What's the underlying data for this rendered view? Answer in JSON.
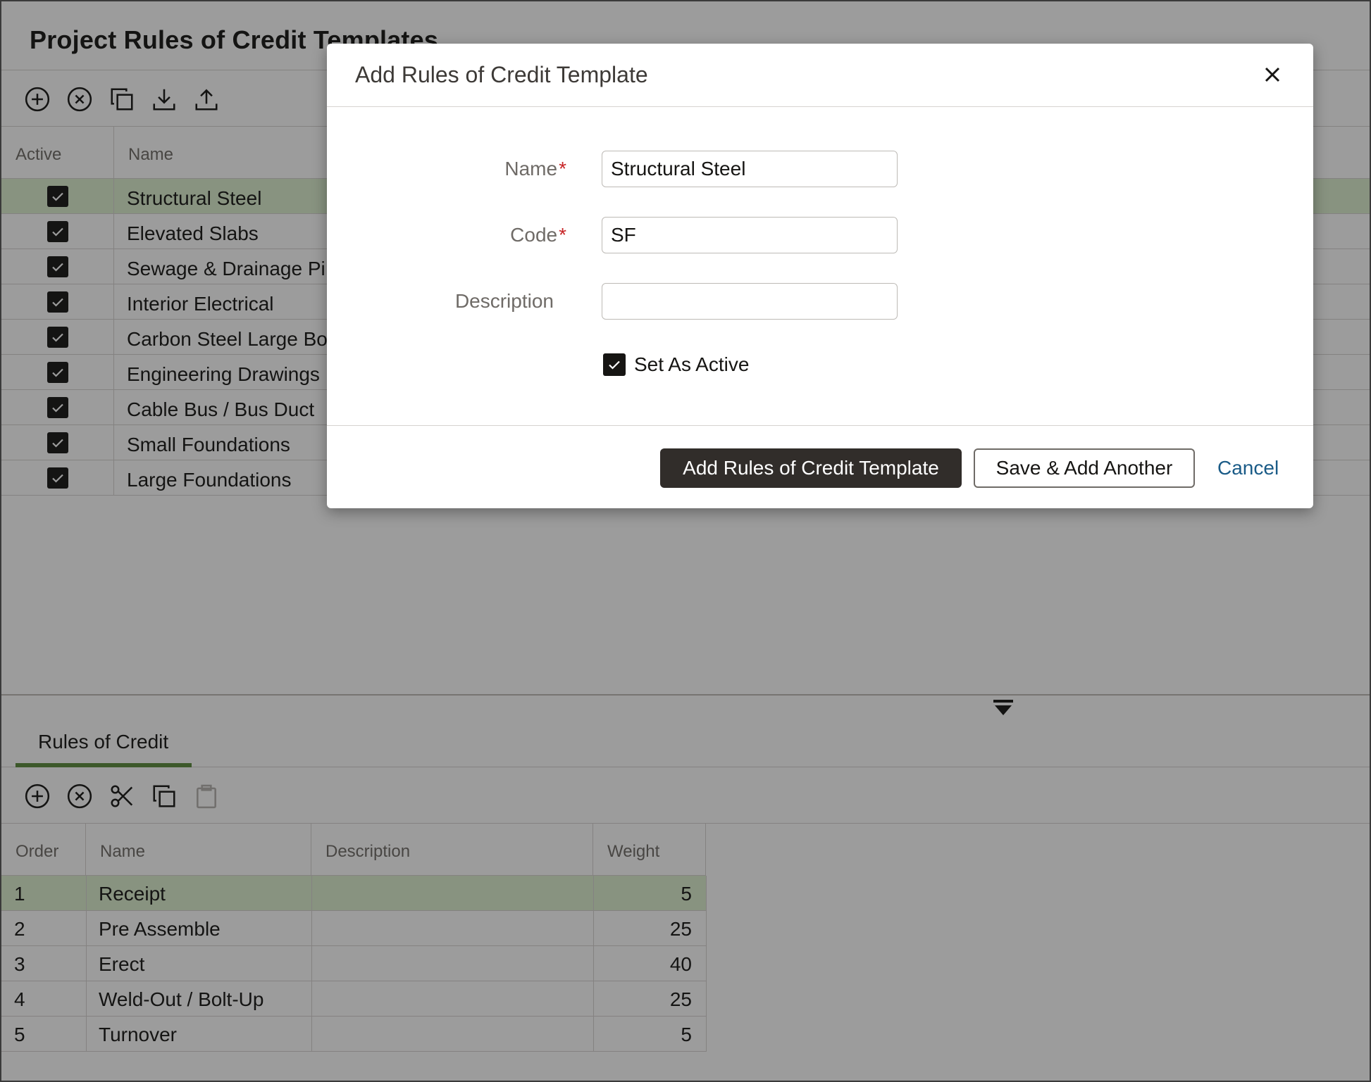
{
  "page": {
    "title": "Project Rules of Credit Templates"
  },
  "top_grid": {
    "columns": {
      "active": "Active",
      "name": "Name"
    },
    "rows": [
      {
        "name": "Structural Steel",
        "active": true
      },
      {
        "name": "Elevated Slabs",
        "active": true
      },
      {
        "name": "Sewage & Drainage Pi",
        "active": true
      },
      {
        "name": "Interior Electrical",
        "active": true
      },
      {
        "name": "Carbon Steel Large Bo",
        "active": true
      },
      {
        "name": "Engineering Drawings",
        "active": true
      },
      {
        "name": "Cable Bus / Bus Duct",
        "active": true
      },
      {
        "name": "Small Foundations",
        "active": true
      },
      {
        "name": "Large Foundations",
        "active": true
      }
    ]
  },
  "tabs": [
    {
      "label": "Rules of Credit"
    }
  ],
  "bottom_grid": {
    "columns": {
      "order": "Order",
      "name": "Name",
      "description": "Description",
      "weight": "Weight"
    },
    "rows": [
      {
        "order": "1",
        "name": "Receipt",
        "description": "",
        "weight": "5"
      },
      {
        "order": "2",
        "name": "Pre Assemble",
        "description": "",
        "weight": "25"
      },
      {
        "order": "3",
        "name": "Erect",
        "description": "",
        "weight": "40"
      },
      {
        "order": "4",
        "name": "Weld-Out / Bolt-Up",
        "description": "",
        "weight": "25"
      },
      {
        "order": "5",
        "name": "Turnover",
        "description": "",
        "weight": "5"
      }
    ]
  },
  "dialog": {
    "title": "Add Rules of Credit Template",
    "fields": {
      "name_label": "Name",
      "name_value": "Structural Steel",
      "code_label": "Code",
      "code_value": "SF",
      "description_label": "Description",
      "description_value": "",
      "required_mark": "*"
    },
    "set_active_label": "Set As Active",
    "set_active_checked": true,
    "buttons": {
      "primary": "Add Rules of Credit Template",
      "secondary": "Save & Add Another",
      "cancel": "Cancel"
    }
  },
  "colors": {
    "selected_row": "#dcefcf",
    "tab_underline": "#5a8a3c",
    "primary_button": "#312d2a",
    "link": "#1a5b87",
    "required": "#c72426"
  }
}
